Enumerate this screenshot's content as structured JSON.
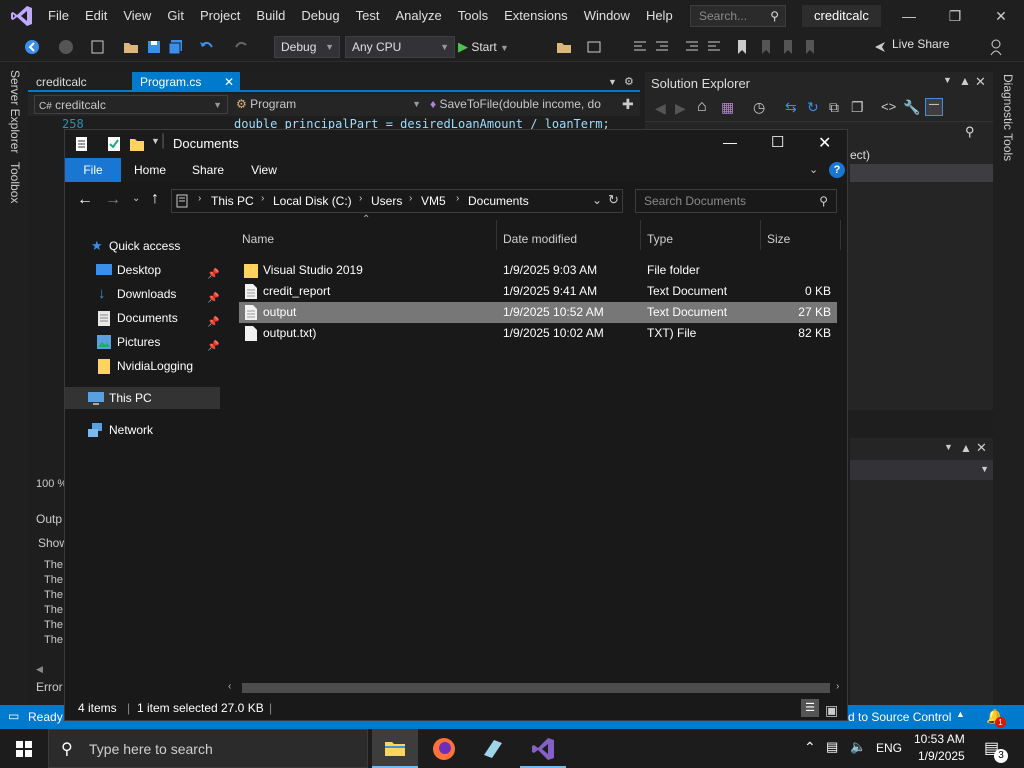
{
  "vs": {
    "menu": [
      "File",
      "Edit",
      "View",
      "Git",
      "Project",
      "Build",
      "Debug",
      "Test",
      "Analyze",
      "Tools",
      "Extensions",
      "Window",
      "Help"
    ],
    "search_placeholder": "Search...",
    "solution_title": "creditcalc",
    "config": "Debug",
    "platform": "Any CPU",
    "start_label": "Start",
    "live_share": "Live Share",
    "left_strip": [
      "Server Explorer",
      "Toolbox"
    ],
    "right_strip": "Diagnostic Tools",
    "tabs": [
      {
        "label": "creditcalc"
      },
      {
        "label": "Program.cs"
      }
    ],
    "nav": {
      "project": "creditcalc",
      "class": "Program",
      "method": "SaveToFile(double income, do"
    },
    "code_line_number": "258",
    "code_line": "double principalPart = desiredLoanAmount / loanTerm;",
    "zoom": "100 %",
    "solution_explorer_title": "Solution Explorer",
    "sol_partial": "ect)",
    "output_title": "Outp",
    "output_show": "Show",
    "output_lines": [
      "The",
      "The",
      "The",
      "The",
      "The",
      "The"
    ],
    "error_tab": "Error",
    "status_ready": "Ready",
    "status_source": "d to Source Control",
    "notif_count": "1"
  },
  "taskbar": {
    "search_placeholder": "Type here to search",
    "lang": "ENG",
    "time": "10:53 AM",
    "date": "1/9/2025",
    "notif_count": "3"
  },
  "explorer": {
    "title": "Documents",
    "ribbon_tabs": [
      "File",
      "Home",
      "Share",
      "View"
    ],
    "breadcrumb": [
      "This PC",
      "Local Disk (C:)",
      "Users",
      "VM5",
      "Documents"
    ],
    "search_placeholder": "Search Documents",
    "nav_items": [
      {
        "label": "Quick access",
        "icon": "star-icon",
        "pinned": false
      },
      {
        "label": "Desktop",
        "icon": "desktop-icon",
        "pinned": true
      },
      {
        "label": "Downloads",
        "icon": "download-icon",
        "pinned": true
      },
      {
        "label": "Documents",
        "icon": "document-icon",
        "pinned": true
      },
      {
        "label": "Pictures",
        "icon": "pictures-icon",
        "pinned": true
      },
      {
        "label": "NvidiaLogging",
        "icon": "folder-icon",
        "pinned": false
      },
      {
        "label": "This PC",
        "icon": "computer-icon",
        "pinned": false
      },
      {
        "label": "Network",
        "icon": "network-icon",
        "pinned": false
      }
    ],
    "columns": [
      "Name",
      "Date modified",
      "Type",
      "Size"
    ],
    "files": [
      {
        "name": "Visual Studio 2019",
        "date": "1/9/2025 9:03 AM",
        "type": "File folder",
        "size": "",
        "icon": "folder-icon",
        "selected": false
      },
      {
        "name": "credit_report",
        "date": "1/9/2025 9:41 AM",
        "type": "Text Document",
        "size": "0 KB",
        "icon": "text-file-icon",
        "selected": false
      },
      {
        "name": "output",
        "date": "1/9/2025 10:52 AM",
        "type": "Text Document",
        "size": "27 KB",
        "icon": "text-file-icon",
        "selected": true
      },
      {
        "name": "output.txt)",
        "date": "1/9/2025 10:02 AM",
        "type": "TXT) File",
        "size": "82 KB",
        "icon": "file-icon",
        "selected": false
      }
    ],
    "status": {
      "items": "4 items",
      "selected": "1 item selected",
      "size": "27.0 KB"
    }
  },
  "colors": {
    "accent": "#007acc",
    "vs_purple": "#8661c5",
    "folder": "#ffd35c",
    "selection": "#777777"
  }
}
